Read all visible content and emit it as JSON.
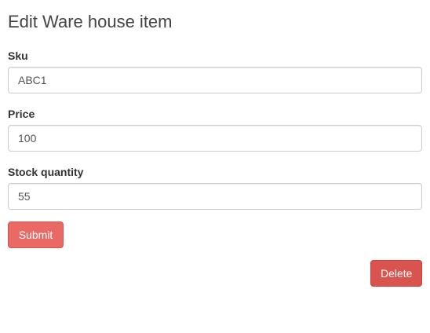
{
  "page": {
    "title": "Edit Ware house item"
  },
  "form": {
    "fields": [
      {
        "label": "Sku",
        "value": "ABC1"
      },
      {
        "label": "Price",
        "value": "100"
      },
      {
        "label": "Stock quantity",
        "value": "55"
      }
    ],
    "submit_label": "Submit",
    "delete_label": "Delete"
  },
  "colors": {
    "submit_button": "#e96a64",
    "delete_button": "#d9534f",
    "input_border": "#cccccc"
  }
}
